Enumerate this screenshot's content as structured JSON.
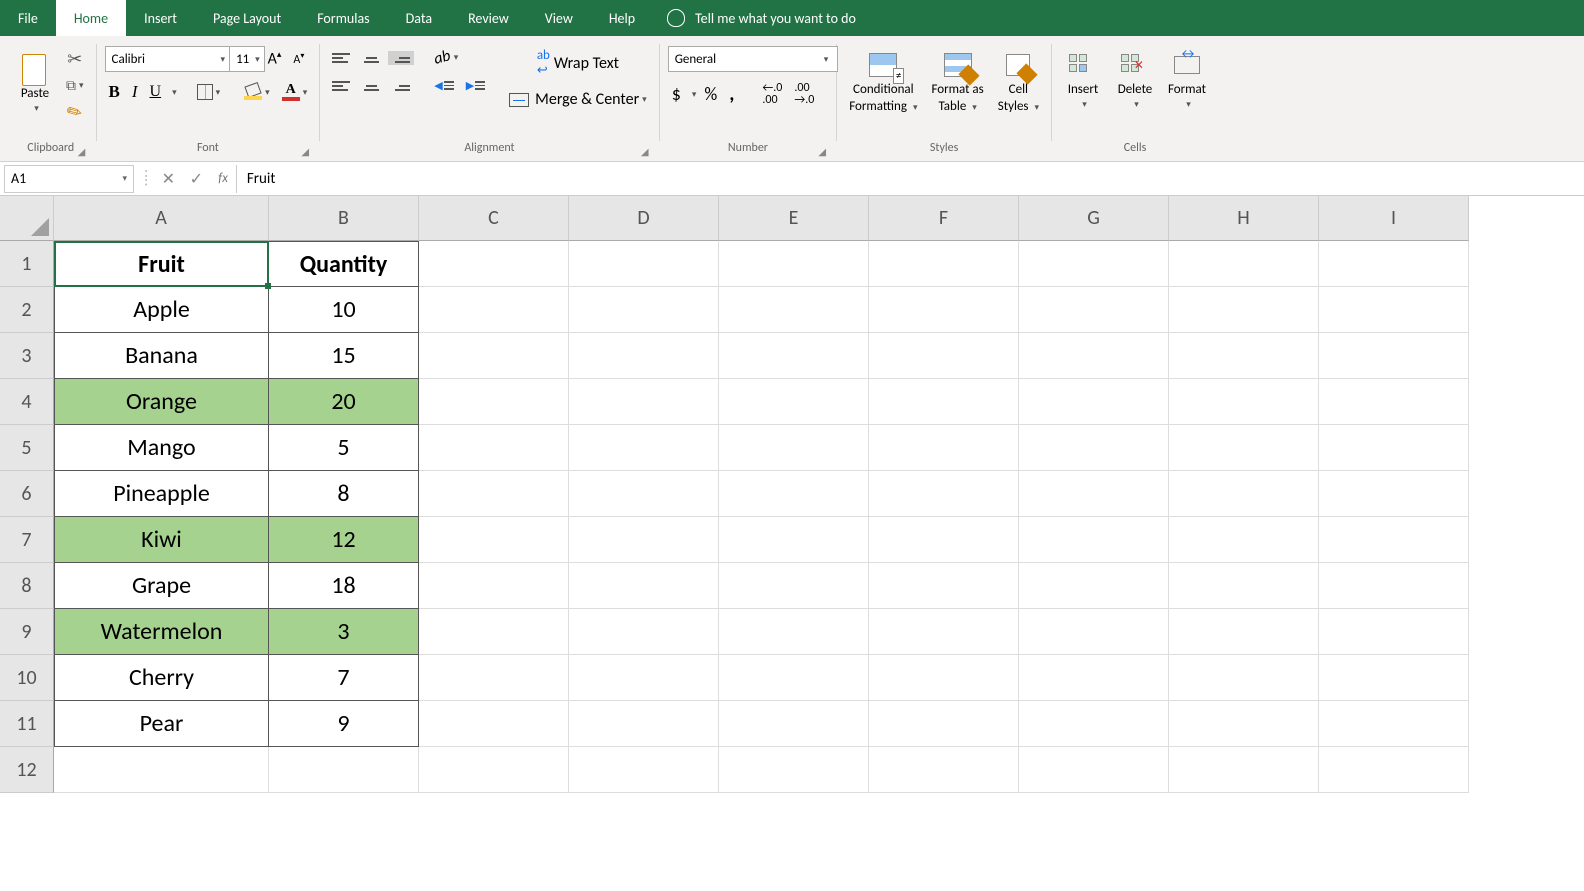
{
  "tabs": [
    "File",
    "Home",
    "Insert",
    "Page Layout",
    "Formulas",
    "Data",
    "Review",
    "View",
    "Help"
  ],
  "activeTab": "Home",
  "tellMe": "Tell me what you want to do",
  "ribbon": {
    "clipboard": {
      "label": "Clipboard",
      "paste": "Paste"
    },
    "font": {
      "label": "Font",
      "name": "Calibri",
      "size": "11"
    },
    "alignment": {
      "label": "Alignment",
      "wrap": "Wrap Text",
      "merge": "Merge & Center"
    },
    "number": {
      "label": "Number",
      "format": "General"
    },
    "styles": {
      "label": "Styles",
      "cond": "Conditional",
      "cond2": "Formatting",
      "fmt": "Format as",
      "fmt2": "Table",
      "cell": "Cell",
      "cell2": "Styles"
    },
    "cells": {
      "label": "Cells",
      "insert": "Insert",
      "delete": "Delete",
      "format": "Format"
    }
  },
  "nameBox": "A1",
  "formula": "Fruit",
  "columns": [
    "A",
    "B",
    "C",
    "D",
    "E",
    "F",
    "G",
    "H",
    "I"
  ],
  "rowLabels": [
    "1",
    "2",
    "3",
    "4",
    "5",
    "6",
    "7",
    "8",
    "9",
    "10",
    "11",
    "12"
  ],
  "table": {
    "headers": [
      "Fruit",
      "Quantity"
    ],
    "rows": [
      {
        "fruit": "Apple",
        "qty": "10",
        "hl": false
      },
      {
        "fruit": "Banana",
        "qty": "15",
        "hl": false
      },
      {
        "fruit": "Orange",
        "qty": "20",
        "hl": true
      },
      {
        "fruit": "Mango",
        "qty": "5",
        "hl": false
      },
      {
        "fruit": "Pineapple",
        "qty": "8",
        "hl": false
      },
      {
        "fruit": "Kiwi",
        "qty": "12",
        "hl": true
      },
      {
        "fruit": "Grape",
        "qty": "18",
        "hl": false
      },
      {
        "fruit": "Watermelon",
        "qty": "3",
        "hl": true
      },
      {
        "fruit": "Cherry",
        "qty": "7",
        "hl": false
      },
      {
        "fruit": "Pear",
        "qty": "9",
        "hl": false
      }
    ]
  }
}
